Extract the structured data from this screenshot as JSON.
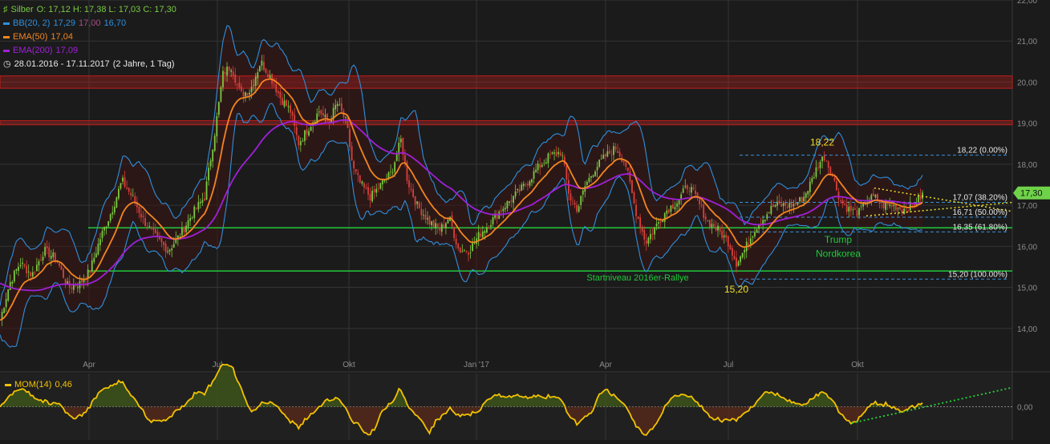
{
  "colors": {
    "background": "#1b1b1b",
    "grid": "#343434",
    "axis_text": "#8c8c8c",
    "candle_up": "#7ac943",
    "candle_down": "#d9403a",
    "bollinger": "#2f8fdc",
    "ema50": "#f3861f",
    "ema200": "#a020d8",
    "resistance": "#c0201d",
    "support": "#21c93a",
    "fib": "#3b8fd9",
    "trend_dotted": "#f2e02a",
    "momentum": "#f2c200",
    "momentum_trend": "#24d63a",
    "price_badge": "#6fd34a"
  },
  "legend": {
    "instrument": "Silber",
    "ohlc": "O: 17,12  H: 17,38  L: 17,03  C: 17,30",
    "bb_label": "BB(20, 2)",
    "bb_values": [
      "17,29",
      "17,00",
      "16,70"
    ],
    "ema50_label": "EMA(50)",
    "ema50_value": "17,04",
    "ema200_label": "EMA(200)",
    "ema200_value": "17,09",
    "period": "28.01.2016 - 17.11.2017",
    "range": "(2 Jahre, 1 Tag)",
    "mom_label": "MOM(14)",
    "mom_value": "0,46",
    "last_price": "17,30"
  },
  "chart_data": [
    {
      "type": "candlestick",
      "x_ticks": [
        "Apr",
        "Jul",
        "Okt",
        "Jan '17",
        "Apr",
        "Jul",
        "Okt"
      ],
      "y_ticks": [
        "14,00",
        "15,00",
        "16,00",
        "17,00",
        "18,00",
        "19,00",
        "20,00",
        "21,00",
        "22,00"
      ],
      "ylim": [
        13.0,
        22.0
      ],
      "grid": true,
      "price_path_key_points": [
        [
          0,
          14.2
        ],
        [
          12,
          15.1
        ],
        [
          25,
          15.6
        ],
        [
          40,
          15.3
        ],
        [
          55,
          15.9
        ],
        [
          70,
          15.7
        ],
        [
          85,
          15.0
        ],
        [
          100,
          15.1
        ],
        [
          112,
          15.4
        ],
        [
          125,
          16.2
        ],
        [
          140,
          16.9
        ],
        [
          152,
          17.6
        ],
        [
          165,
          17.2
        ],
        [
          180,
          16.6
        ],
        [
          195,
          16.2
        ],
        [
          210,
          15.9
        ],
        [
          225,
          16.3
        ],
        [
          240,
          16.8
        ],
        [
          255,
          17.2
        ],
        [
          268,
          18.8
        ],
        [
          278,
          20.2
        ],
        [
          288,
          20.4
        ],
        [
          300,
          19.7
        ],
        [
          312,
          19.8
        ],
        [
          325,
          20.5
        ],
        [
          338,
          20.1
        ],
        [
          350,
          19.6
        ],
        [
          362,
          19.3
        ],
        [
          372,
          18.5
        ],
        [
          385,
          18.9
        ],
        [
          398,
          19.3
        ],
        [
          410,
          19.0
        ],
        [
          420,
          19.5
        ],
        [
          432,
          19.0
        ],
        [
          440,
          17.9
        ],
        [
          450,
          17.5
        ],
        [
          462,
          17.2
        ],
        [
          475,
          17.5
        ],
        [
          488,
          17.8
        ],
        [
          500,
          18.6
        ],
        [
          508,
          17.6
        ],
        [
          520,
          17.0
        ],
        [
          535,
          16.6
        ],
        [
          548,
          16.4
        ],
        [
          560,
          16.7
        ],
        [
          572,
          15.9
        ],
        [
          585,
          15.9
        ],
        [
          598,
          16.3
        ],
        [
          612,
          16.6
        ],
        [
          625,
          16.9
        ],
        [
          640,
          17.2
        ],
        [
          655,
          17.5
        ],
        [
          670,
          17.9
        ],
        [
          685,
          18.2
        ],
        [
          700,
          18.3
        ],
        [
          710,
          17.2
        ],
        [
          720,
          16.9
        ],
        [
          730,
          17.5
        ],
        [
          742,
          17.9
        ],
        [
          755,
          18.2
        ],
        [
          768,
          18.4
        ],
        [
          780,
          18.0
        ],
        [
          792,
          16.9
        ],
        [
          805,
          16.1
        ],
        [
          818,
          16.5
        ],
        [
          832,
          16.9
        ],
        [
          845,
          17.1
        ],
        [
          858,
          17.5
        ],
        [
          870,
          17.1
        ],
        [
          882,
          16.6
        ],
        [
          895,
          16.4
        ],
        [
          908,
          16.1
        ],
        [
          918,
          15.6
        ],
        [
          928,
          15.9
        ],
        [
          940,
          16.4
        ],
        [
          952,
          16.7
        ],
        [
          965,
          17.0
        ],
        [
          978,
          17.0
        ],
        [
          990,
          17.0
        ],
        [
          1002,
          17.2
        ],
        [
          1012,
          17.6
        ],
        [
          1020,
          18.0
        ],
        [
          1028,
          18.2
        ],
        [
          1038,
          17.7
        ],
        [
          1048,
          17.1
        ],
        [
          1058,
          16.9
        ],
        [
          1070,
          16.8
        ],
        [
          1080,
          17.1
        ],
        [
          1090,
          17.2
        ],
        [
          1100,
          17.0
        ],
        [
          1112,
          17.0
        ],
        [
          1125,
          16.9
        ],
        [
          1138,
          17.0
        ],
        [
          1152,
          17.3
        ]
      ],
      "horizontal_bands": [
        {
          "kind": "resistance",
          "from": 19.85,
          "to": 20.15
        },
        {
          "kind": "resistance",
          "from": 18.96,
          "to": 19.06
        }
      ],
      "support_lines": [
        {
          "value": 15.4,
          "label": "Startniveau 2016er-Rallye"
        },
        {
          "value": 16.45,
          "label": ""
        }
      ],
      "fib_levels": [
        {
          "value": 18.22,
          "label": "18,22 (0.00%)"
        },
        {
          "value": 17.07,
          "label": "17,07 (38.20%)"
        },
        {
          "value": 16.71,
          "label": "16,71 (50.00%)"
        },
        {
          "value": 16.35,
          "label": "16,35 (61.80%)"
        },
        {
          "value": 15.2,
          "label": "15,20 (100.00%)"
        }
      ],
      "annotations": [
        {
          "text": "18,22",
          "at": 18.5
        },
        {
          "text": "15,20",
          "at": 14.95
        },
        {
          "text": "Trump",
          "at": 16.2
        },
        {
          "text": "Nordkorea",
          "at": 15.9
        }
      ]
    },
    {
      "type": "line",
      "name": "MOM(14)",
      "y_ticks": [
        "0,00"
      ],
      "ylim": [
        -2.0,
        2.0
      ],
      "zero_line": true
    }
  ]
}
